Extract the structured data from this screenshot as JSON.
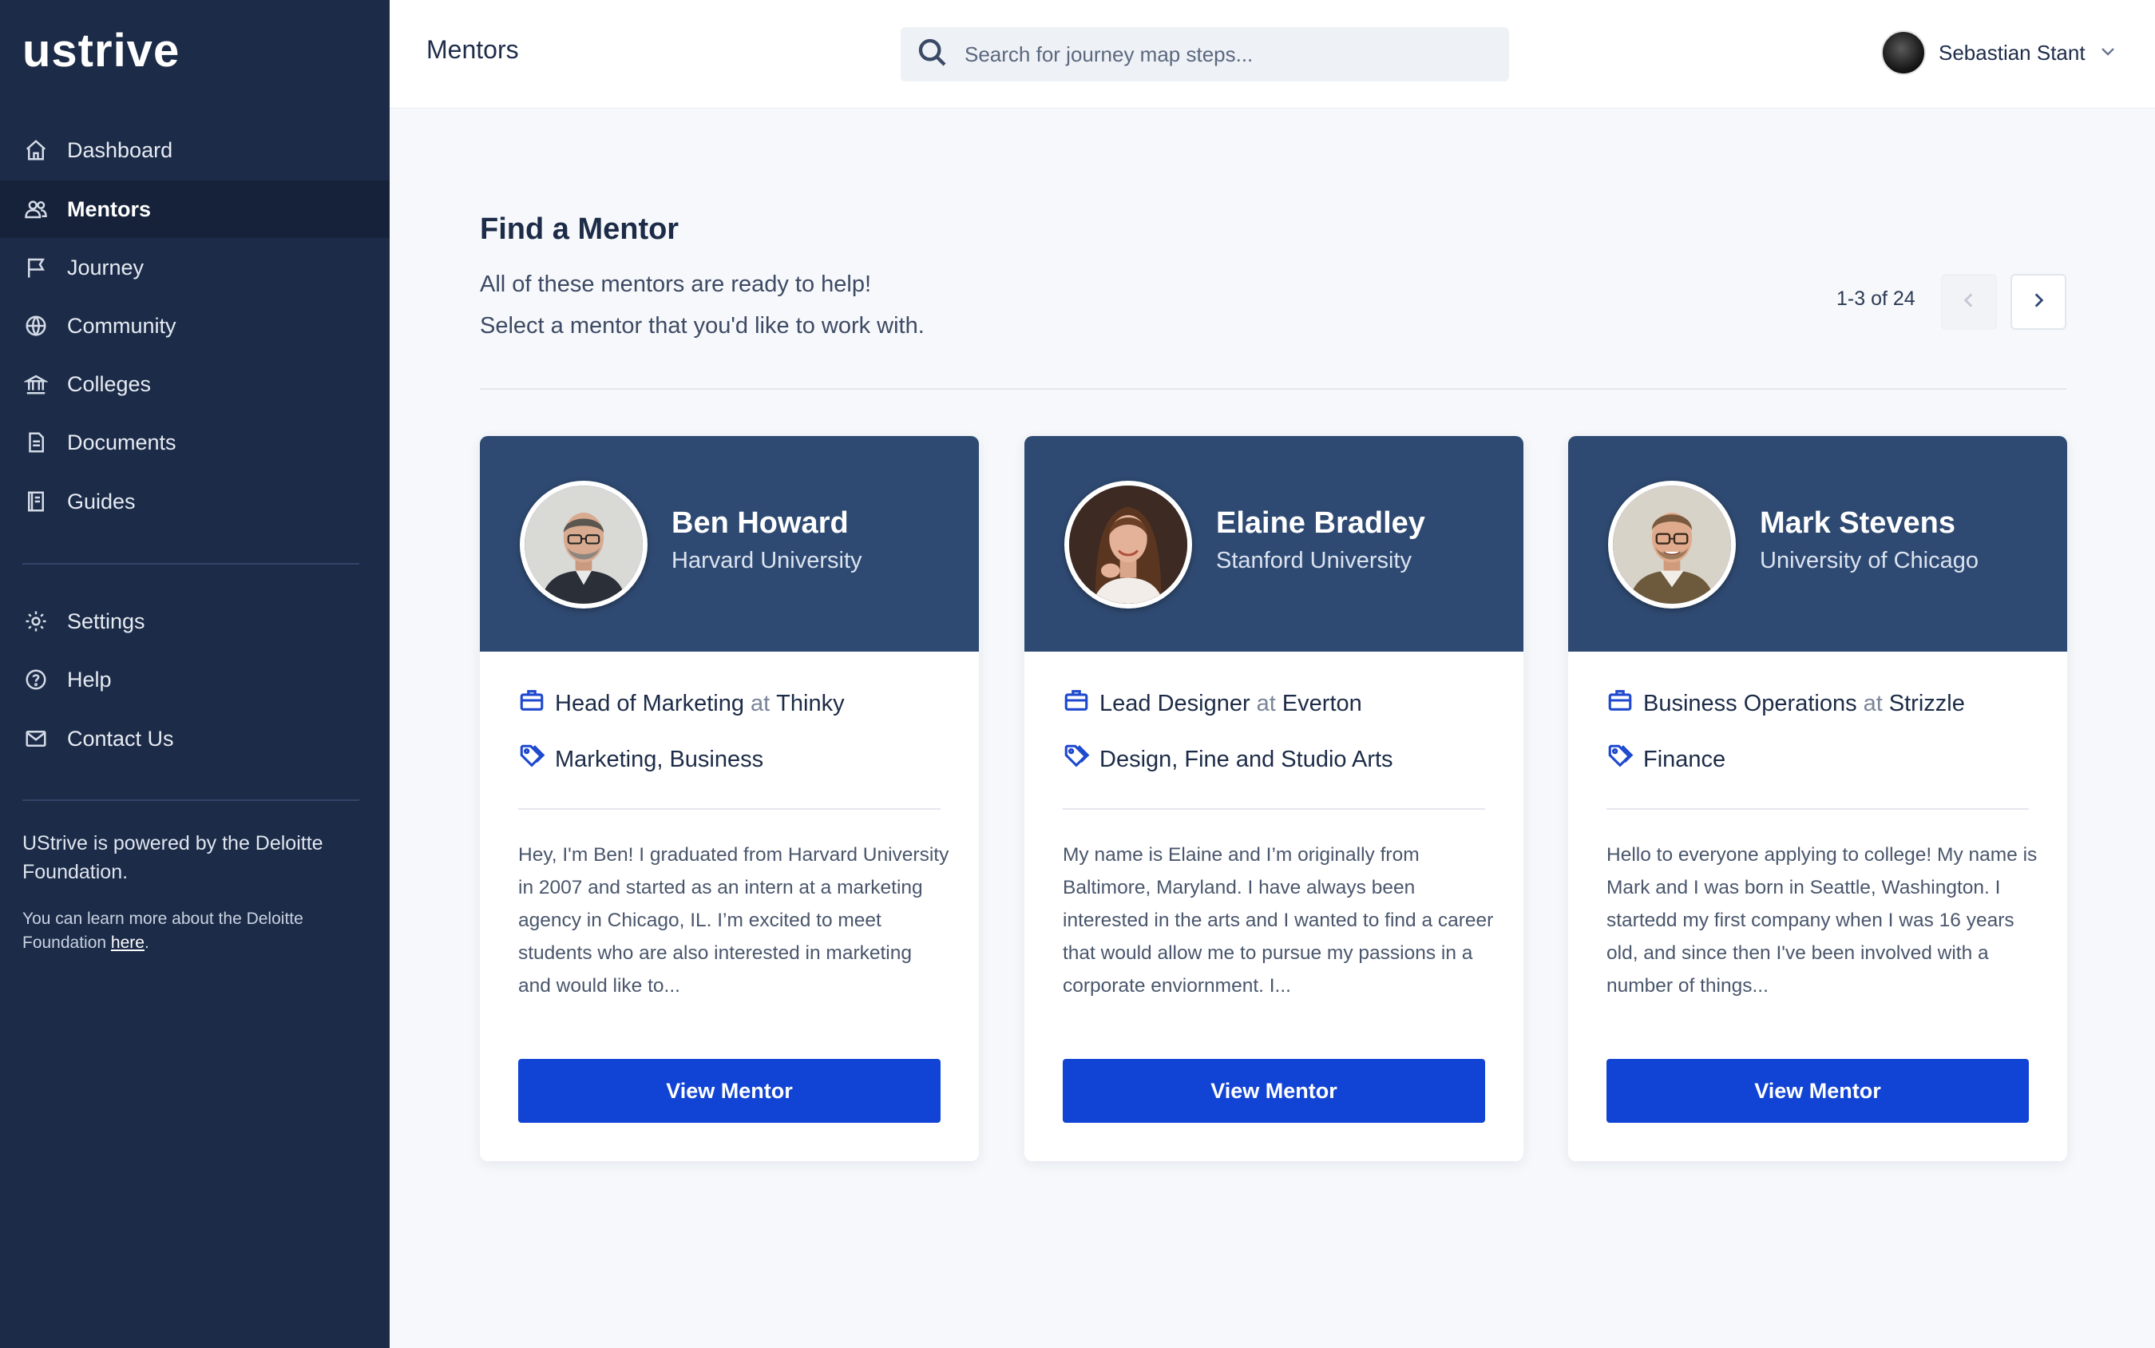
{
  "sidebar": {
    "logo": "ustrive",
    "items": [
      {
        "label": "Dashboard",
        "icon": "home-icon"
      },
      {
        "label": "Mentors",
        "icon": "users-icon",
        "active": true
      },
      {
        "label": "Journey",
        "icon": "flag-icon"
      },
      {
        "label": "Community",
        "icon": "globe-icon"
      },
      {
        "label": "Colleges",
        "icon": "bank-icon"
      },
      {
        "label": "Documents",
        "icon": "document-icon"
      },
      {
        "label": "Guides",
        "icon": "book-icon"
      }
    ],
    "secondary_items": [
      {
        "label": "Settings",
        "icon": "gear-icon"
      },
      {
        "label": "Help",
        "icon": "help-circle-icon"
      },
      {
        "label": "Contact Us",
        "icon": "mail-icon"
      }
    ],
    "powered_by": "UStrive is powered by the Deloitte Foundation.",
    "learn_more_prefix": "You can learn more about the Deloitte Foundation ",
    "learn_more_link": "here",
    "learn_more_suffix": "."
  },
  "header": {
    "title": "Mentors",
    "search_placeholder": "Search for journey map steps...",
    "user_name": "Sebastian Stant"
  },
  "main": {
    "heading": "Find a Mentor",
    "subtitle_line1": "All of these mentors are ready to help!",
    "subtitle_line2": "Select a mentor that you'd like to work with.",
    "pagination": "1-3 of 24"
  },
  "mentors": [
    {
      "name": "Ben Howard",
      "school": "Harvard University",
      "role": "Head of Marketing",
      "at": "at",
      "company": "Thinky",
      "tags": "Marketing, Business",
      "bio": "Hey, I'm Ben! I graduated from Harvard University in 2007 and started as an intern at a marketing agency in Chicago, IL. I’m excited to meet students who are also interested in marketing and would like to...",
      "button": "View Mentor"
    },
    {
      "name": "Elaine Bradley",
      "school": "Stanford University",
      "role": "Lead Designer",
      "at": "at",
      "company": "Everton",
      "tags": "Design, Fine and Studio Arts",
      "bio": "My name is Elaine and I’m originally from Baltimore, Maryland. I have always been interested in the arts and I wanted to find a career that would allow me to pursue my passions in a corporate enviornment. I...",
      "button": "View Mentor"
    },
    {
      "name": "Mark Stevens",
      "school": "University of Chicago",
      "role": "Business Operations",
      "at": "at",
      "company": "Strizzle",
      "tags": "Finance",
      "bio": "Hello to everyone applying to college! My name is Mark and I was born in Seattle, Washington. I startedd my first company when I was 16 years old, and since then I've been involved with a number of things...",
      "button": "View Mentor"
    }
  ],
  "colors": {
    "sidebar_bg": "#1c2b47",
    "card_header": "#2f4a72",
    "primary_button": "#1144d4"
  }
}
